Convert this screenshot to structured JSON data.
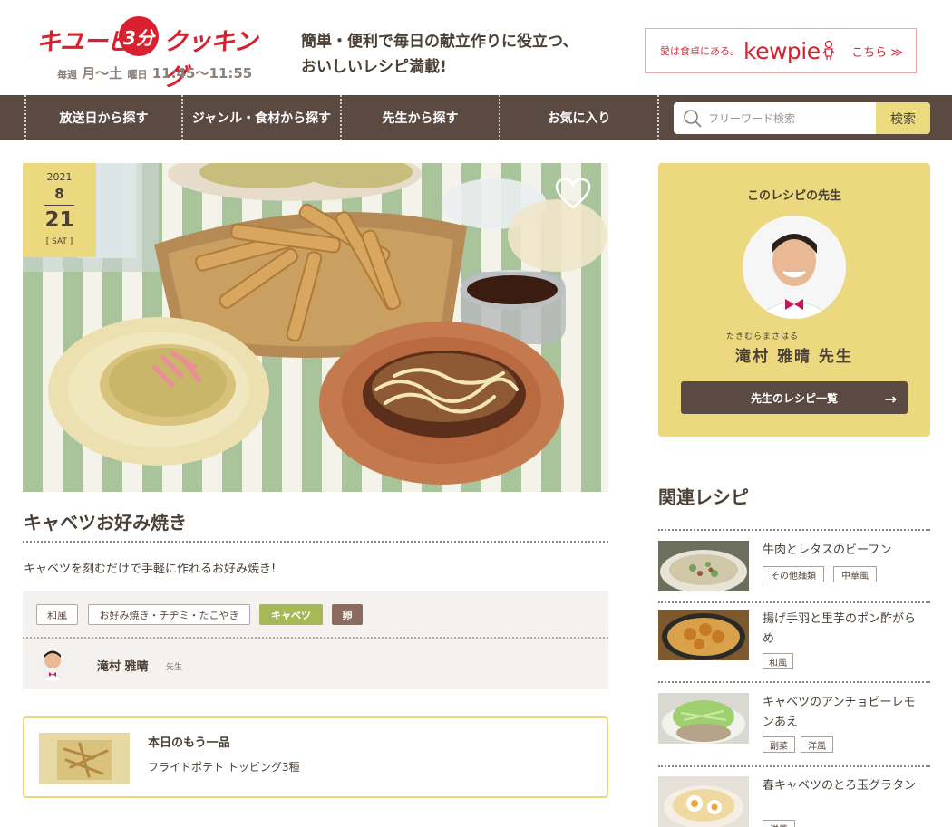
{
  "header": {
    "logo_part1": "キユーピー",
    "logo_badge": "3分",
    "logo_part2": "クッキング",
    "onair_prefix": "毎週",
    "onair_days": "月〜土",
    "onair_suffix": "曜日",
    "onair_time": "11:45〜11:55",
    "tagline": "簡単・便利で毎日の献立作りに役立つ、\nおいしいレシピ満載!",
    "kewpie_banner": {
      "love": "愛は食卓にある。",
      "brand": "kewpie",
      "link": "こちら ≫"
    }
  },
  "nav": {
    "items": [
      "放送日から探す",
      "ジャンル・食材から探す",
      "先生から探す",
      "お気に入り"
    ],
    "search_placeholder": "フリーワード検索",
    "search_button": "検索"
  },
  "recipe": {
    "date": {
      "year": "2021",
      "month": "8",
      "day": "21",
      "weekday": "[ SAT ]"
    },
    "title": "キャベツお好み焼き",
    "description": "キャベツを刻むだけで手軽に作れるお好み焼き!",
    "tags": [
      {
        "label": "和風",
        "style": "outline"
      },
      {
        "label": "お好み焼き・チヂミ・たこやき",
        "style": "outline"
      },
      {
        "label": "キャベツ",
        "style": "green",
        "color": "#a6b858"
      },
      {
        "label": "卵",
        "style": "brown",
        "color": "#8b6a5f"
      }
    ],
    "teacher_name": "滝村 雅晴",
    "teacher_suffix": "先生"
  },
  "one_more": {
    "heading": "本日のもう一品",
    "name": "フライドポテト トッピング3種"
  },
  "teacher_card": {
    "heading": "このレシピの先生",
    "ruby": "たきむらまさはる",
    "name": "滝村 雅晴 先生",
    "button": "先生のレシピ一覧",
    "button_icon": "→"
  },
  "related": {
    "title": "関連レシピ",
    "items": [
      {
        "name": "牛肉とレタスのビーフン",
        "tags": [
          "その他麺類",
          "中華風"
        ]
      },
      {
        "name": "揚げ手羽と里芋のポン酢がらめ",
        "tags": [
          "和風"
        ]
      },
      {
        "name": "キャベツのアンチョビーレモンあえ",
        "tags": [
          "副菜",
          "洋風"
        ]
      },
      {
        "name": "春キャベツのとろ玉グラタン",
        "tags": [
          "洋風"
        ]
      }
    ]
  },
  "colors": {
    "brand_red": "#d8202f",
    "nav_brown": "#5b4a42",
    "accent_yellow": "#ecd97f",
    "text_brown": "#4a4036"
  }
}
